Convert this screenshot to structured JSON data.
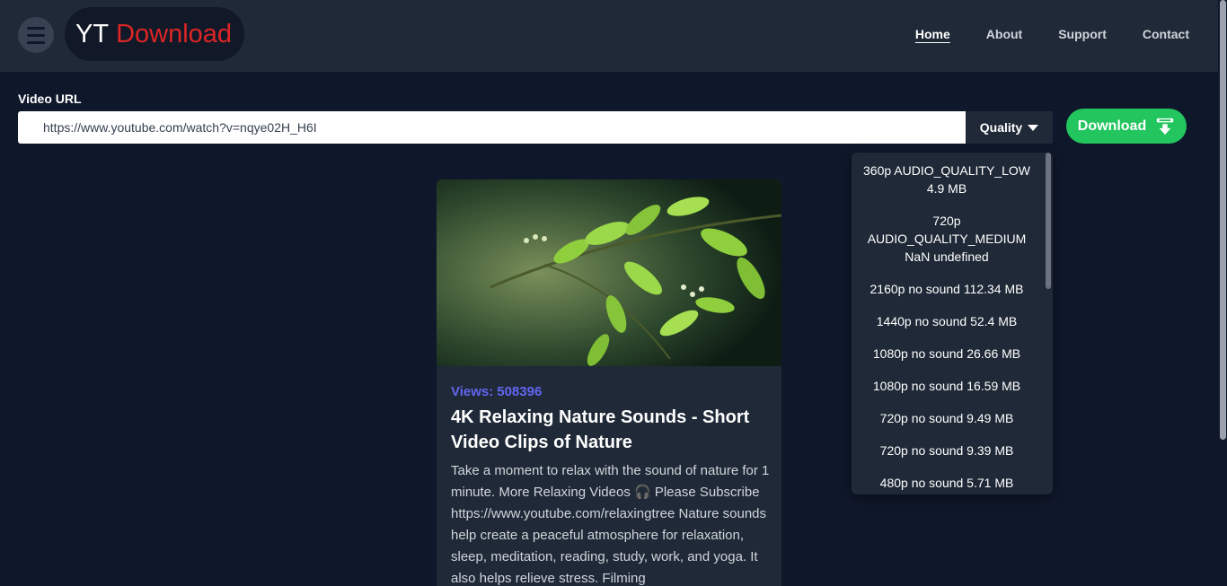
{
  "nav": {
    "logo_yt": "YT",
    "logo_download": "Download",
    "links": [
      "Home",
      "About",
      "Support",
      "Contact"
    ],
    "active": "Home"
  },
  "form": {
    "url_label": "Video URL",
    "url_value": "https://www.youtube.com/watch?v=nqye02H_H6I",
    "quality_label": "Quality",
    "download_label": "Download"
  },
  "quality_options": [
    "360p AUDIO_QUALITY_LOW 4.9 MB",
    "720p AUDIO_QUALITY_MEDIUM NaN undefined",
    "2160p no sound 112.34 MB",
    "1440p no sound 52.4 MB",
    "1080p no sound 26.66 MB",
    "1080p no sound 16.59 MB",
    "720p no sound 9.49 MB",
    "720p no sound 9.39 MB",
    "480p no sound 5.71 MB"
  ],
  "video": {
    "views_label": "Views:",
    "views": "508396",
    "title": "4K Relaxing Nature Sounds - Short Video Clips of Nature",
    "description": "Take a moment to relax with the sound of nature for 1 minute. More Relaxing Videos 🎧 Please Subscribe https://www.youtube.com/relaxingtree Nature sounds help create a peaceful atmosphere for relaxation, sleep, meditation, reading, study, work, and yoga. It also helps relieve stress. Filming"
  },
  "colors": {
    "accent_red": "#dc2626",
    "download_green": "#22c55e",
    "views_indigo": "#6366f1",
    "background": "#0f172a"
  }
}
